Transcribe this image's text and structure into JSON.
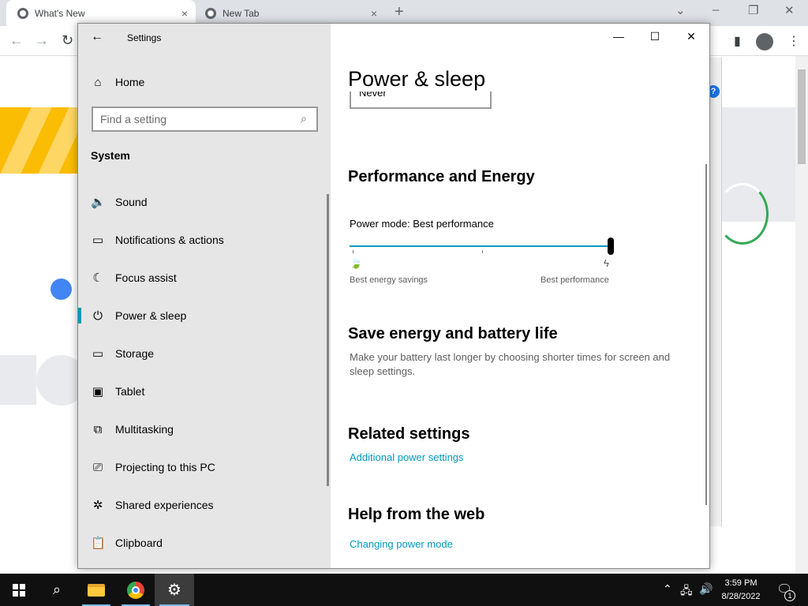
{
  "browser": {
    "tabs": [
      {
        "label": "What's New",
        "close_glyph": "×"
      },
      {
        "label": "New Tab",
        "close_glyph": "×"
      }
    ],
    "new_tab_glyph": "+",
    "help_glyph": "?"
  },
  "settings": {
    "app_title": "Settings",
    "home_label": "Home",
    "search_placeholder": "Find a setting",
    "section_heading": "System",
    "nav_items": [
      {
        "label": "Sound",
        "icon": "speaker-icon"
      },
      {
        "label": "Notifications & actions",
        "icon": "notification-icon"
      },
      {
        "label": "Focus assist",
        "icon": "moon-icon"
      },
      {
        "label": "Power & sleep",
        "icon": "power-icon",
        "selected": true
      },
      {
        "label": "Storage",
        "icon": "storage-icon"
      },
      {
        "label": "Tablet",
        "icon": "tablet-icon"
      },
      {
        "label": "Multitasking",
        "icon": "multitasking-icon"
      },
      {
        "label": "Projecting to this PC",
        "icon": "projecting-icon"
      },
      {
        "label": "Shared experiences",
        "icon": "shared-experiences-icon"
      },
      {
        "label": "Clipboard",
        "icon": "clipboard-icon"
      }
    ],
    "content": {
      "page_title": "Power & sleep",
      "dropdown_remnant": "Never",
      "performance_heading": "Performance and Energy",
      "power_mode_label": "Power mode: Best performance",
      "power_mode_level": 1.0,
      "slider_min_label": "Best energy savings",
      "slider_max_label": "Best performance",
      "save_energy_heading": "Save energy and battery life",
      "save_energy_text": "Make your battery last longer by choosing shorter times for screen and sleep settings.",
      "related_heading": "Related settings",
      "related_link": "Additional power settings",
      "help_heading": "Help from the web",
      "help_link": "Changing power mode"
    }
  },
  "taskbar": {
    "time": "3:59 PM",
    "date": "8/28/2022",
    "notification_count": "1"
  },
  "colors": {
    "accent": "#0099bc",
    "taskbar": "#101010",
    "settings_nav_bg": "#e6e6e6"
  }
}
